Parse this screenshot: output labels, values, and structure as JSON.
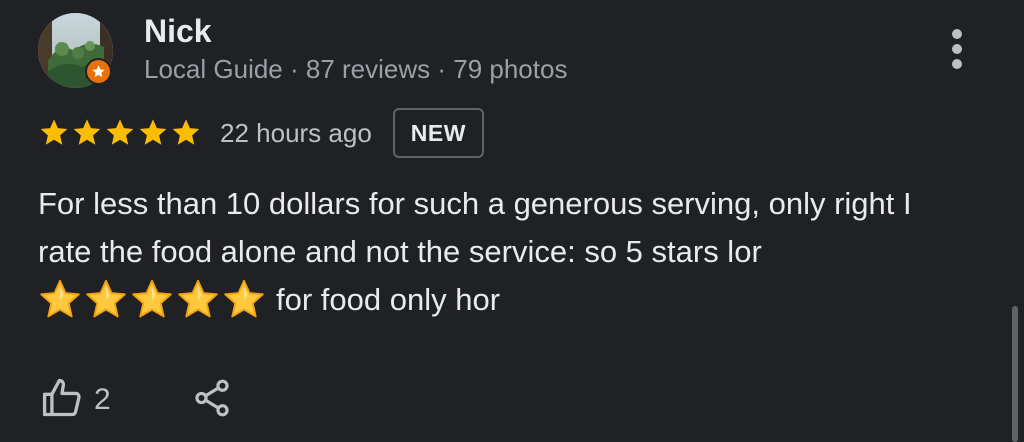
{
  "reviewer": {
    "name": "Nick",
    "meta": "Local Guide · 87 reviews · 79 photos",
    "badge_icon": "local-guide-star-icon",
    "badge_color": "#e8710a"
  },
  "review": {
    "rating": 5,
    "max_rating": 5,
    "star_color": "#fbbc04",
    "time": "22 hours ago",
    "badge": "NEW",
    "text_line1": "For less than 10 dollars for such a generous serving, only right I",
    "text_line2": "rate the food alone and not the service: so 5 stars lor",
    "emoji_stars": "⭐⭐⭐⭐⭐",
    "text_line3_after_emoji": "for food only hor"
  },
  "actions": {
    "like_icon": "thumbs-up-icon",
    "like_count": "2",
    "share_icon": "share-icon",
    "more_icon": "more-vertical-icon"
  }
}
